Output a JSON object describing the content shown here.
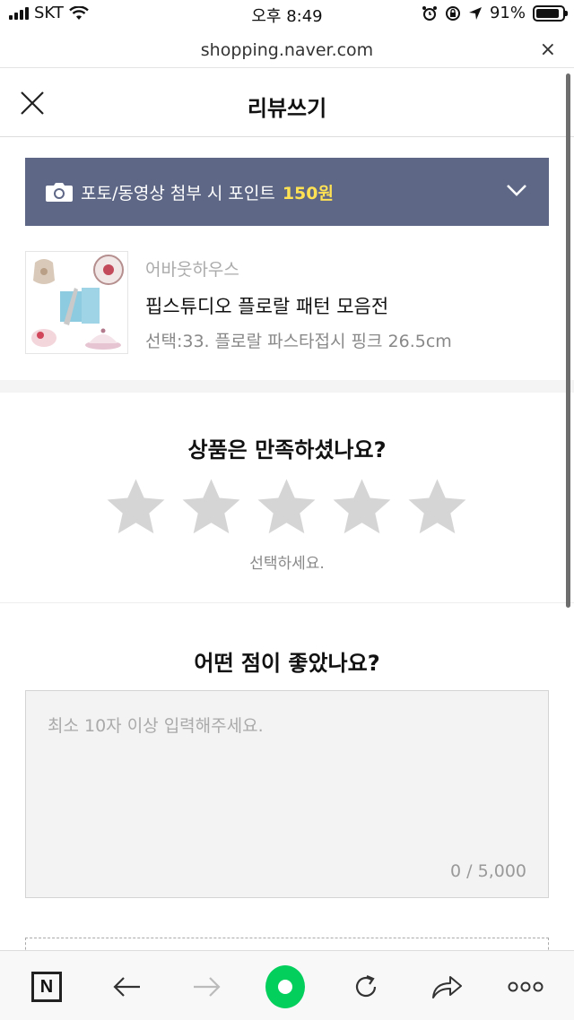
{
  "status_bar": {
    "carrier": "SKT",
    "time": "오후 8:49",
    "battery_percent": "91%",
    "battery_level": 0.91
  },
  "browser": {
    "url": "shopping.naver.com",
    "close_glyph": "×"
  },
  "header": {
    "title": "리뷰쓰기"
  },
  "banner": {
    "text": "포토/동영상 첨부 시 포인트",
    "points": "150원",
    "background": "#5e6786",
    "points_color": "#ffe154"
  },
  "product": {
    "brand": "어바웃하우스",
    "name": "핍스튜디오 플로랄 패턴 모음전",
    "option": "선택:33. 플로랄 파스타접시 핑크 26.5cm"
  },
  "rating": {
    "title": "상품은 만족하셨나요?",
    "hint": "선택하세요.",
    "max_stars": 5,
    "selected": 0,
    "star_color": "#d5d5d5"
  },
  "review": {
    "title": "어떤 점이 좋았나요?",
    "placeholder": "최소 10자 이상 입력해주세요.",
    "value": "",
    "counter": "0 / 5,000"
  },
  "toolbar": {
    "naver_label": "N",
    "accent": "#03cf5d",
    "icons": [
      "naver-home-icon",
      "back-arrow-icon",
      "forward-arrow-icon",
      "green-dot-icon",
      "refresh-icon",
      "share-icon",
      "more-icon"
    ]
  }
}
